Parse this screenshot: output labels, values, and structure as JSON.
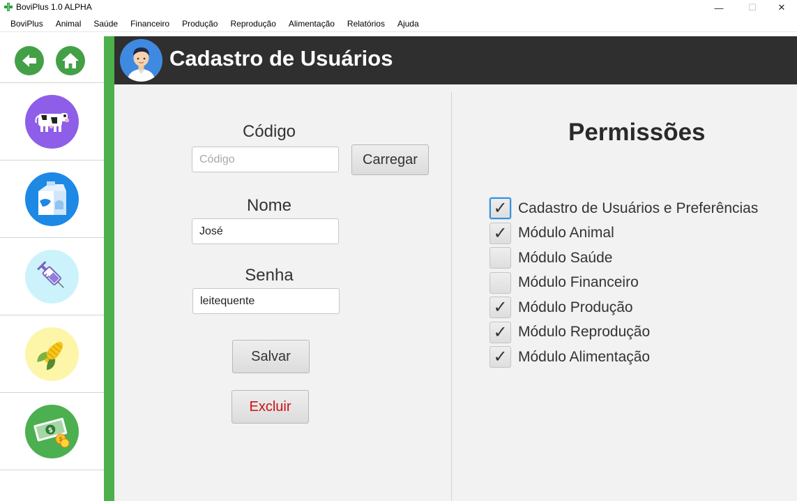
{
  "window": {
    "title": "BoviPlus 1.0 ALPHA",
    "minimize": "—",
    "maximize": "☐",
    "close": "✕"
  },
  "menu": [
    "BoviPlus",
    "Animal",
    "Saúde",
    "Financeiro",
    "Produção",
    "Reprodução",
    "Alimentação",
    "Relatórios",
    "Ajuda"
  ],
  "sidebar": {
    "items": [
      {
        "name": "animal-module-icon",
        "bg": "#8e5ee8"
      },
      {
        "name": "production-module-icon",
        "bg": "#1e88e5"
      },
      {
        "name": "health-module-icon",
        "bg": "#ccf3fb"
      },
      {
        "name": "feeding-module-icon",
        "bg": "#fdf5a8"
      },
      {
        "name": "finance-module-icon",
        "bg": "#4caf50"
      }
    ]
  },
  "header": {
    "title": "Cadastro de Usuários"
  },
  "form": {
    "codigo_label": "Código",
    "codigo_placeholder": "Código",
    "codigo_value": "",
    "carregar_label": "Carregar",
    "nome_label": "Nome",
    "nome_value": "José",
    "senha_label": "Senha",
    "senha_value": "leitequente",
    "salvar_label": "Salvar",
    "excluir_label": "Excluir"
  },
  "permissions": {
    "title": "Permissões",
    "items": [
      {
        "label": "Cadastro de Usuários e Preferências",
        "checked": true,
        "focused": true
      },
      {
        "label": "Módulo Animal",
        "checked": true,
        "focused": false
      },
      {
        "label": "Módulo Saúde",
        "checked": false,
        "focused": false
      },
      {
        "label": "Módulo Financeiro",
        "checked": false,
        "focused": false
      },
      {
        "label": "Módulo Produção",
        "checked": true,
        "focused": false
      },
      {
        "label": "Módulo Reprodução",
        "checked": true,
        "focused": false
      },
      {
        "label": "Módulo Alimentação",
        "checked": true,
        "focused": false
      }
    ],
    "check_glyph": "✓"
  },
  "colors": {
    "accent_green": "#4cb04b",
    "header_bg": "#2f2f2f",
    "danger_text": "#cc1111"
  }
}
